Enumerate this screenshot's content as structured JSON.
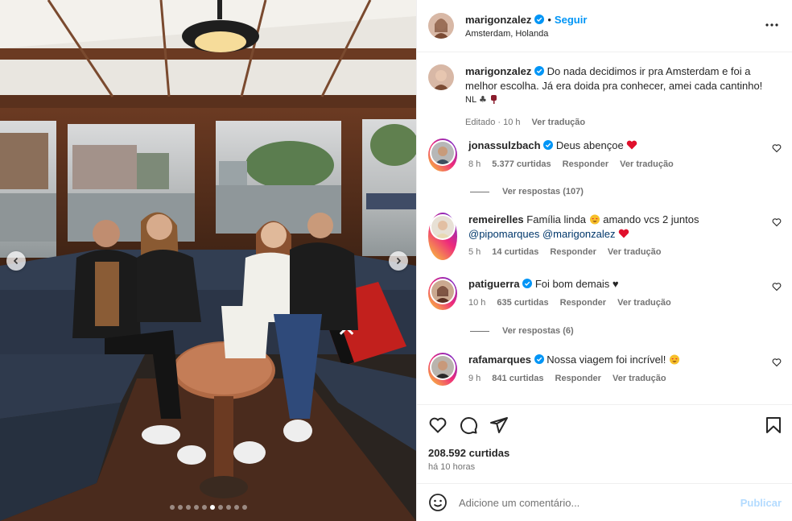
{
  "post": {
    "author": "marigonzalez",
    "follow_label": "Seguir",
    "separator": "•",
    "location": "Amsterdam, Holanda",
    "caption": "Do nada decidimos ir pra Amsterdam e foi a melhor escolha. Já era doida pra conhecer, amei cada cantinho!",
    "caption_tail": "NL",
    "edited": "Editado · 10 h",
    "see_translation": "Ver tradução"
  },
  "comments": [
    {
      "user": "jonassulzbach",
      "text": "Deus abençoe",
      "time": "8 h",
      "likes": "5.377 curtidas",
      "reply": "Responder",
      "translate": "Ver tradução",
      "replies_label": "Ver respostas (107)"
    },
    {
      "user": "remeirelles",
      "text": "Família linda",
      "text2": "amando vcs 2 juntos",
      "mention1": "@pipomarques",
      "mention2": "@marigonzalez",
      "time": "5 h",
      "likes": "14 curtidas",
      "reply": "Responder",
      "translate": "Ver tradução"
    },
    {
      "user": "patiguerra",
      "text": "Foi bom demais ♥",
      "time": "10 h",
      "likes": "635 curtidas",
      "reply": "Responder",
      "translate": "Ver tradução",
      "replies_label": "Ver respostas (6)"
    },
    {
      "user": "rafamarques",
      "text": "Nossa viagem foi incrível!",
      "time": "9 h",
      "likes": "841 curtidas",
      "reply": "Responder",
      "translate": "Ver tradução"
    }
  ],
  "footer": {
    "likes": "208.592 curtidas",
    "posted": "há 10 horas",
    "comment_placeholder": "Adicione um comentário...",
    "publish": "Publicar"
  },
  "carousel": {
    "count": 10,
    "active_index": 5
  },
  "colors": {
    "verified": "#0095f6",
    "heart": "#ff3040",
    "link": "#00376b",
    "accent": "#0095f6"
  }
}
